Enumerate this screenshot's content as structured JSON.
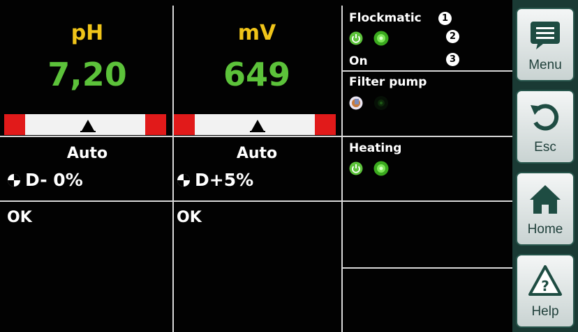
{
  "colors": {
    "label_yellow": "#f0c419",
    "value_green": "#5cc23a",
    "alarm_red": "#e11a1a",
    "nav_teal": "#1a3a34"
  },
  "channels": [
    {
      "label": "pH",
      "value": "7,20",
      "mode": "Auto",
      "dosing": "D- 0%",
      "status": "OK"
    },
    {
      "label": "mV",
      "value": "649",
      "mode": "Auto",
      "dosing": "D+5%",
      "status": "OK"
    }
  ],
  "right_panel": {
    "flockmatic": {
      "title": "Flockmatic",
      "state": "On",
      "markers": [
        "1",
        "2",
        "3"
      ],
      "icons": [
        "power-on-icon",
        "active-lamp-icon"
      ]
    },
    "filter_pump": {
      "title": "Filter pump",
      "icons": [
        "pump-icon",
        "inactive-lamp-icon"
      ]
    },
    "heating": {
      "title": "Heating",
      "icons": [
        "power-on-icon",
        "active-lamp-icon"
      ]
    }
  },
  "nav": [
    {
      "label": "Menu",
      "icon": "menu-icon"
    },
    {
      "label": "Esc",
      "icon": "undo-icon"
    },
    {
      "label": "Home",
      "icon": "home-icon"
    },
    {
      "label": "Help",
      "icon": "help-icon"
    }
  ]
}
